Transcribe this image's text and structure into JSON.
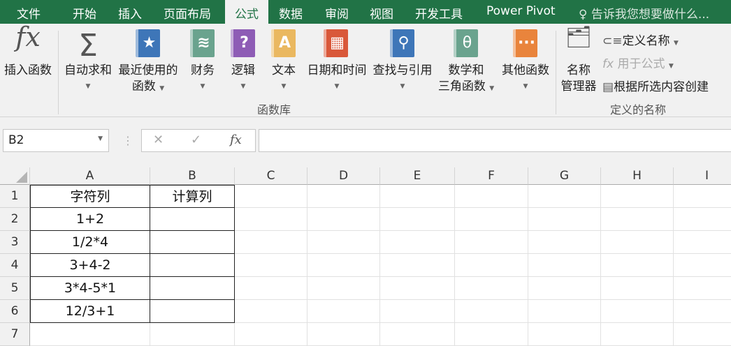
{
  "tabs": [
    "文件",
    "开始",
    "插入",
    "页面布局",
    "公式",
    "数据",
    "审阅",
    "视图",
    "开发工具",
    "Power Pivot"
  ],
  "tell_me": "告诉我您想要做什么...",
  "ribbon": {
    "insert_function": "插入函数",
    "autosum": "自动求和",
    "recent_1": "最近使用的",
    "recent_2": "函数",
    "financial": "财务",
    "logical": "逻辑",
    "text": "文本",
    "datetime": "日期和时间",
    "lookup": "查找与引用",
    "math_1": "数学和",
    "math_2": "三角函数",
    "more": "其他函数",
    "group_library": "函数库",
    "name_manager_1": "名称",
    "name_manager_2": "管理器",
    "define_name": "定义名称",
    "use_in_formula": "用于公式",
    "create_from_selection": "根据所选内容创建",
    "group_names": "定义的名称"
  },
  "formula_bar": {
    "name_box": "B2",
    "fx": "fx",
    "formula": ""
  },
  "columns": [
    "A",
    "B",
    "C",
    "D",
    "E",
    "F",
    "G",
    "H",
    "I"
  ],
  "rows": [
    {
      "n": "1",
      "a": "字符列",
      "b": "计算列"
    },
    {
      "n": "2",
      "a": "1+2",
      "b": ""
    },
    {
      "n": "3",
      "a": "1/2*4",
      "b": ""
    },
    {
      "n": "4",
      "a": "3+4-2",
      "b": ""
    },
    {
      "n": "5",
      "a": "3*4-5*1",
      "b": ""
    },
    {
      "n": "6",
      "a": "12/3+1",
      "b": ""
    },
    {
      "n": "7",
      "a": "",
      "b": ""
    }
  ]
}
